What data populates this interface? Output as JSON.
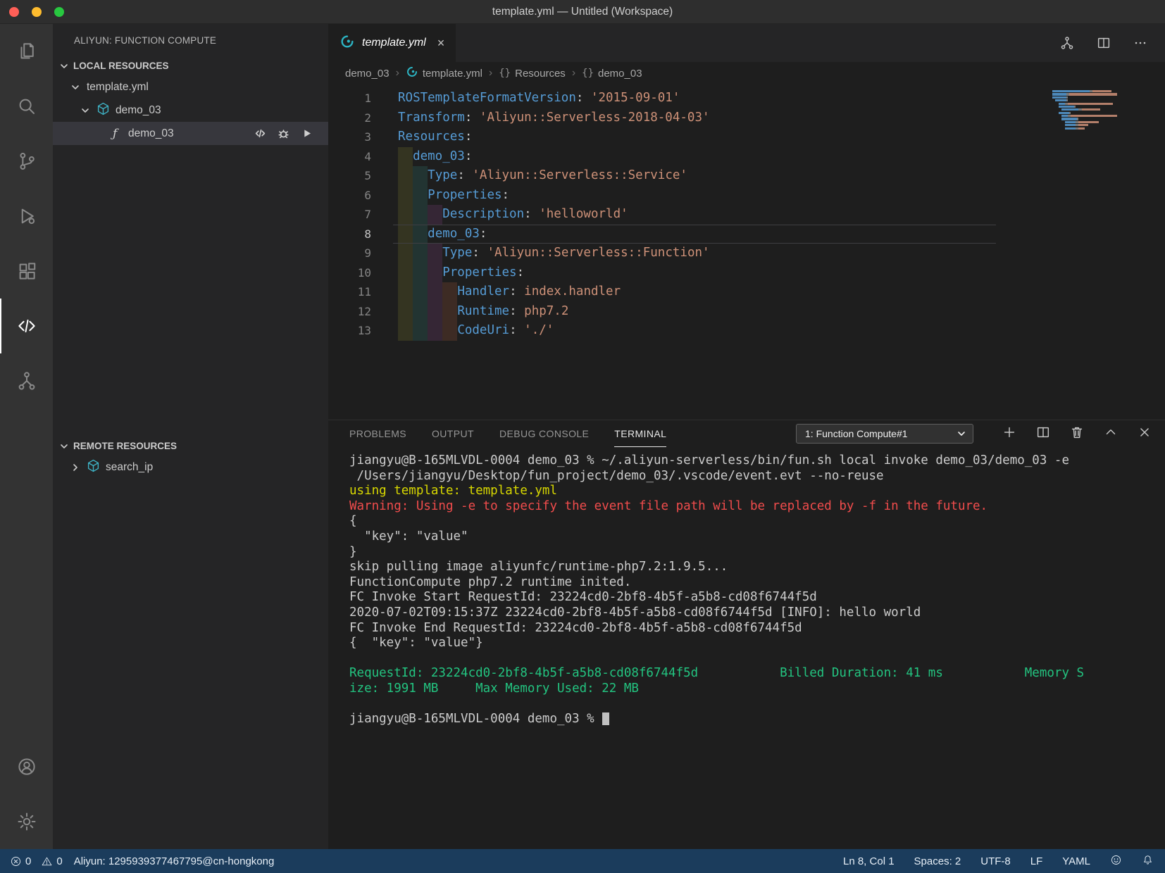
{
  "colors": {
    "statusbar-bg": "#1b3c5c",
    "key-blue": "#569cd6",
    "string-orange": "#ce9178",
    "terminal-green": "#23c480",
    "terminal-red": "#f14c4c",
    "terminal-yellow": "#d8d800",
    "cube-teal": "#3fb5c8",
    "fc-teal": "#2cb5c4"
  },
  "window": {
    "title": "template.yml — Untitled (Workspace)"
  },
  "icons": {
    "function_glyph": "ƒ",
    "braces_glyph": "{}"
  },
  "sidebar": {
    "title": "ALIYUN: FUNCTION COMPUTE",
    "local": {
      "header": "LOCAL RESOURCES",
      "items": [
        {
          "label": "template.yml"
        },
        {
          "label": "demo_03"
        },
        {
          "label": "demo_03"
        }
      ]
    },
    "remote": {
      "header": "REMOTE RESOURCES",
      "items": [
        {
          "label": "search_ip"
        }
      ]
    }
  },
  "editor": {
    "tab": {
      "label": "template.yml",
      "close": "×"
    },
    "crumb_separator": "›",
    "breadcrumbs": [
      {
        "label": "demo_03"
      },
      {
        "label": "template.yml"
      },
      {
        "label": "Resources"
      },
      {
        "label": "demo_03"
      }
    ],
    "active_line": 8,
    "code_lines": [
      {
        "num": 1,
        "indent": 0,
        "tokens": [
          {
            "t": "key",
            "v": "ROSTemplateFormatVersion"
          },
          {
            "t": "punc",
            "v": ": "
          },
          {
            "t": "str",
            "v": "'2015-09-01'"
          }
        ]
      },
      {
        "num": 2,
        "indent": 0,
        "tokens": [
          {
            "t": "key",
            "v": "Transform"
          },
          {
            "t": "punc",
            "v": ": "
          },
          {
            "t": "str",
            "v": "'Aliyun::Serverless-2018-04-03'"
          }
        ]
      },
      {
        "num": 3,
        "indent": 0,
        "tokens": [
          {
            "t": "key",
            "v": "Resources"
          },
          {
            "t": "punc",
            "v": ":"
          }
        ]
      },
      {
        "num": 4,
        "indent": 1,
        "tokens": [
          {
            "t": "key",
            "v": "demo_03"
          },
          {
            "t": "punc",
            "v": ":"
          }
        ]
      },
      {
        "num": 5,
        "indent": 2,
        "tokens": [
          {
            "t": "key",
            "v": "Type"
          },
          {
            "t": "punc",
            "v": ": "
          },
          {
            "t": "str",
            "v": "'Aliyun::Serverless::Service'"
          }
        ]
      },
      {
        "num": 6,
        "indent": 2,
        "tokens": [
          {
            "t": "key",
            "v": "Properties"
          },
          {
            "t": "punc",
            "v": ":"
          }
        ]
      },
      {
        "num": 7,
        "indent": 3,
        "tokens": [
          {
            "t": "key",
            "v": "Description"
          },
          {
            "t": "punc",
            "v": ": "
          },
          {
            "t": "str",
            "v": "'helloworld'"
          }
        ]
      },
      {
        "num": 8,
        "indent": 2,
        "tokens": [
          {
            "t": "key",
            "v": "demo_03"
          },
          {
            "t": "punc",
            "v": ":"
          }
        ]
      },
      {
        "num": 9,
        "indent": 3,
        "tokens": [
          {
            "t": "key",
            "v": "Type"
          },
          {
            "t": "punc",
            "v": ": "
          },
          {
            "t": "str",
            "v": "'Aliyun::Serverless::Function'"
          }
        ]
      },
      {
        "num": 10,
        "indent": 3,
        "tokens": [
          {
            "t": "key",
            "v": "Properties"
          },
          {
            "t": "punc",
            "v": ":"
          }
        ]
      },
      {
        "num": 11,
        "indent": 4,
        "tokens": [
          {
            "t": "key",
            "v": "Handler"
          },
          {
            "t": "punc",
            "v": ": "
          },
          {
            "t": "val",
            "v": "index.handler"
          }
        ]
      },
      {
        "num": 12,
        "indent": 4,
        "tokens": [
          {
            "t": "key",
            "v": "Runtime"
          },
          {
            "t": "punc",
            "v": ": "
          },
          {
            "t": "val",
            "v": "php7.2"
          }
        ]
      },
      {
        "num": 13,
        "indent": 4,
        "tokens": [
          {
            "t": "key",
            "v": "CodeUri"
          },
          {
            "t": "punc",
            "v": ": "
          },
          {
            "t": "str",
            "v": "'./'"
          }
        ]
      }
    ]
  },
  "panel": {
    "tabs": [
      {
        "label": "PROBLEMS"
      },
      {
        "label": "OUTPUT"
      },
      {
        "label": "DEBUG CONSOLE"
      },
      {
        "label": "TERMINAL"
      }
    ],
    "terminal_select": "1: Function Compute#1",
    "terminal_lines": [
      {
        "color": "default",
        "text": "jiangyu@B-165MLVDL-0004 demo_03 % ~/.aliyun-serverless/bin/fun.sh local invoke demo_03/demo_03 -e"
      },
      {
        "color": "default",
        "text": " /Users/jiangyu/Desktop/fun_project/demo_03/.vscode/event.evt --no-reuse"
      },
      {
        "color": "yellow",
        "text": "using template: template.yml"
      },
      {
        "color": "red",
        "text": "Warning: Using -e to specify the event file path will be replaced by -f in the future."
      },
      {
        "color": "default",
        "text": "{"
      },
      {
        "color": "default",
        "text": "  \"key\": \"value\""
      },
      {
        "color": "default",
        "text": "}"
      },
      {
        "color": "default",
        "text": "skip pulling image aliyunfc/runtime-php7.2:1.9.5..."
      },
      {
        "color": "default",
        "text": "FunctionCompute php7.2 runtime inited."
      },
      {
        "color": "default",
        "text": "FC Invoke Start RequestId: 23224cd0-2bf8-4b5f-a5b8-cd08f6744f5d"
      },
      {
        "color": "default",
        "text": "2020-07-02T09:15:37Z 23224cd0-2bf8-4b5f-a5b8-cd08f6744f5d [INFO]: hello world"
      },
      {
        "color": "default",
        "text": "FC Invoke End RequestId: 23224cd0-2bf8-4b5f-a5b8-cd08f6744f5d"
      },
      {
        "color": "default",
        "text": "{  \"key\": \"value\"}"
      },
      {
        "color": "default",
        "text": ""
      },
      {
        "color": "green",
        "text": "RequestId: 23224cd0-2bf8-4b5f-a5b8-cd08f6744f5d           Billed Duration: 41 ms           Memory S"
      },
      {
        "color": "green",
        "text": "ize: 1991 MB     Max Memory Used: 22 MB"
      },
      {
        "color": "default",
        "text": ""
      },
      {
        "color": "default",
        "text": "jiangyu@B-165MLVDL-0004 demo_03 % ",
        "cursor": true
      }
    ]
  },
  "statusbar": {
    "errors": "0",
    "warnings": "0",
    "account": "Aliyun: 1295939377467795@cn-hongkong",
    "cursor": "Ln 8, Col 1",
    "indent": "Spaces: 2",
    "encoding": "UTF-8",
    "eol": "LF",
    "language": "YAML"
  }
}
